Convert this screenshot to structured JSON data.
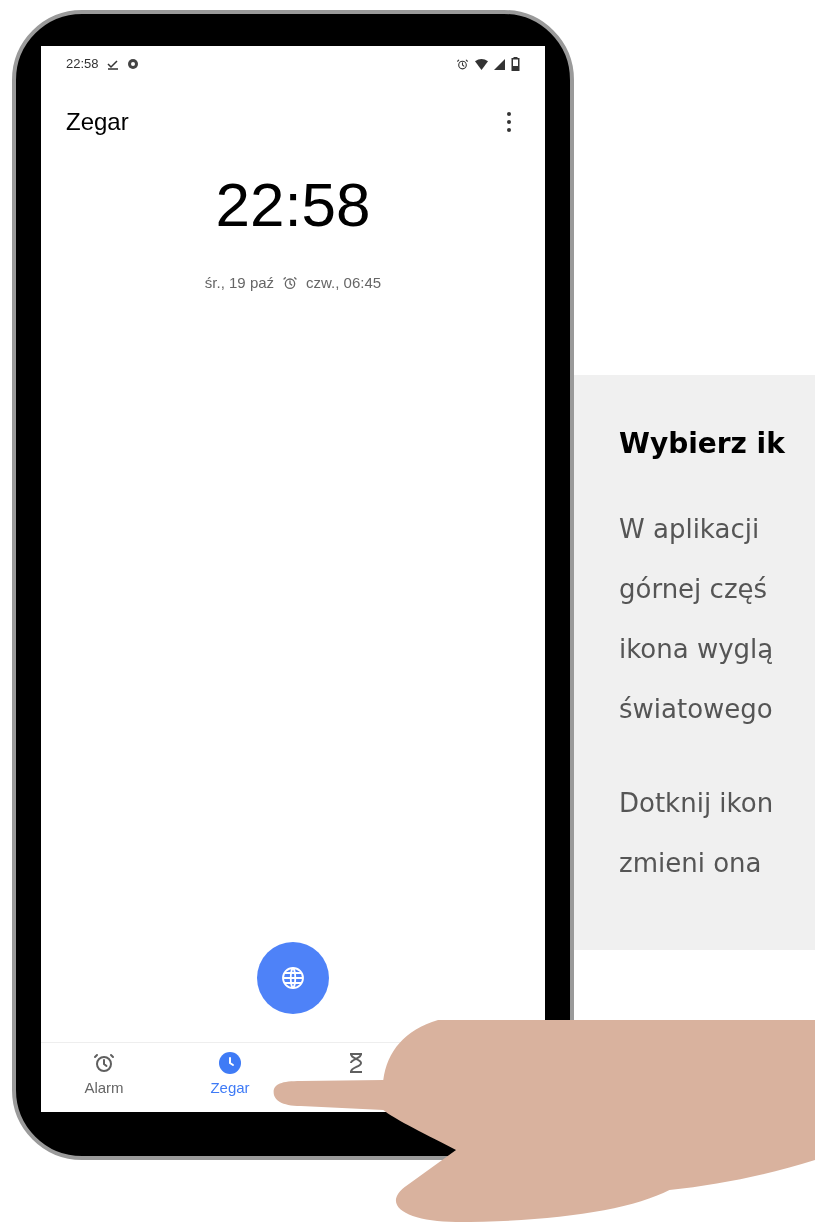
{
  "status_bar": {
    "time": "22:58"
  },
  "app_bar": {
    "title": "Zegar"
  },
  "clock": {
    "time": "22:58",
    "date": "śr., 19 paź",
    "next_alarm": "czw., 06:45"
  },
  "fab": {
    "kind": "globe"
  },
  "bottom_nav": [
    {
      "kind": "alarm",
      "label": "Alarm",
      "selected": false
    },
    {
      "kind": "clock",
      "label": "Zegar",
      "selected": true
    },
    {
      "kind": "timer",
      "selected": false
    }
  ],
  "instruction_card": {
    "title": "Wybierz ik",
    "paragraphs": [
      [
        "W aplikacji",
        "górnej częś",
        "ikona wyglą",
        "światowego"
      ],
      [
        "Dotknij ikon",
        "zmieni ona"
      ]
    ]
  }
}
